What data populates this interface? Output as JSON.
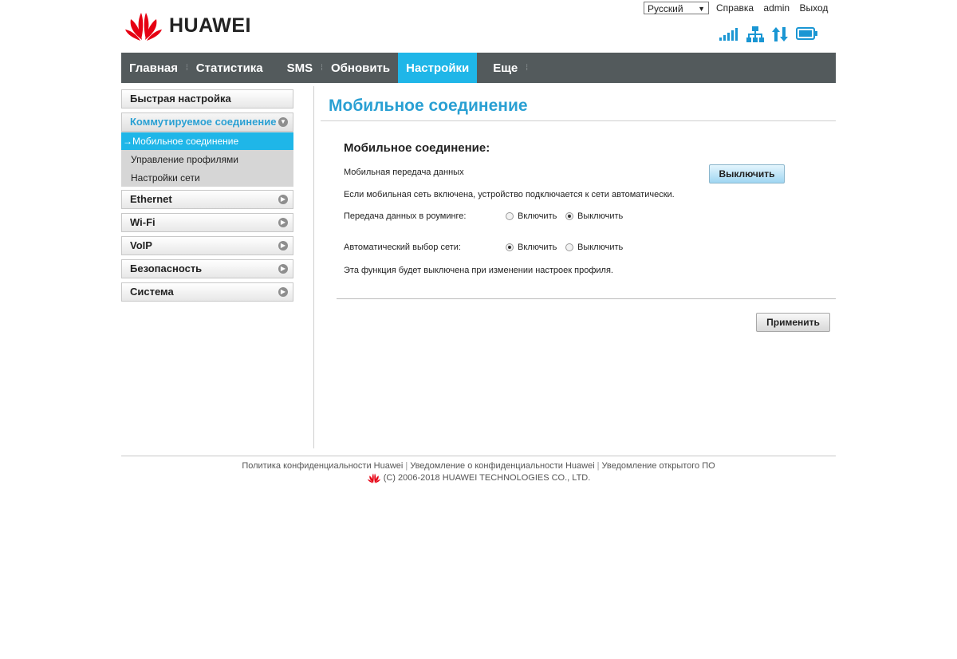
{
  "brand": {
    "name": "HUAWEI",
    "color": "#e60012"
  },
  "header": {
    "language": "Русский",
    "links": [
      "Справка",
      "admin",
      "Выход"
    ],
    "status_icons": [
      "signal-strength-icon",
      "lan-network-icon",
      "data-transfer-icon",
      "display-icon"
    ]
  },
  "nav": {
    "items": [
      {
        "label": "Главная"
      },
      {
        "label": "Статистика"
      },
      {
        "label": "SMS"
      },
      {
        "label": "Обновить"
      },
      {
        "label": "Настройки",
        "active": true
      },
      {
        "label": "Еще"
      }
    ]
  },
  "sidebar": {
    "quick_setup": "Быстрая настройка",
    "dialup": {
      "label": "Коммутируемое соединение",
      "sub": [
        "Мобильное соединение",
        "Управление профилями",
        "Настройки сети"
      ]
    },
    "items": [
      "Ethernet",
      "Wi-Fi",
      "VoIP",
      "Безопасность",
      "Система"
    ]
  },
  "content": {
    "page_title": "Мобильное соединение",
    "section_title": "Мобильное соединение:",
    "mobile_data_label": "Мобильная передача данных",
    "mobile_data_button": "Выключить",
    "auto_connect_note": "Если мобильная сеть включена, устройство подключается к сети автоматически.",
    "roaming_label": "Передача данных в роуминге:",
    "roaming_on": "Включить",
    "roaming_off": "Выключить",
    "auto_network_label": "Автоматический выбор сети:",
    "auto_network_on": "Включить",
    "auto_network_off": "Выключить",
    "profile_note": "Эта функция будет выключена при изменении настроек профиля.",
    "apply_button": "Применить",
    "roaming_selected": "Выключить",
    "auto_network_selected": "Включить"
  },
  "footer": {
    "links": [
      "Политика конфиденциальности Huawei",
      "Уведомление о конфиденциальности Huawei",
      "Уведомление открытого ПО"
    ],
    "copyright": "(C) 2006-2018 HUAWEI TECHNOLOGIES CO., LTD."
  },
  "colors": {
    "accent": "#1fb6e8",
    "nav_bg": "#535a5c",
    "title": "#2aa0d3"
  }
}
